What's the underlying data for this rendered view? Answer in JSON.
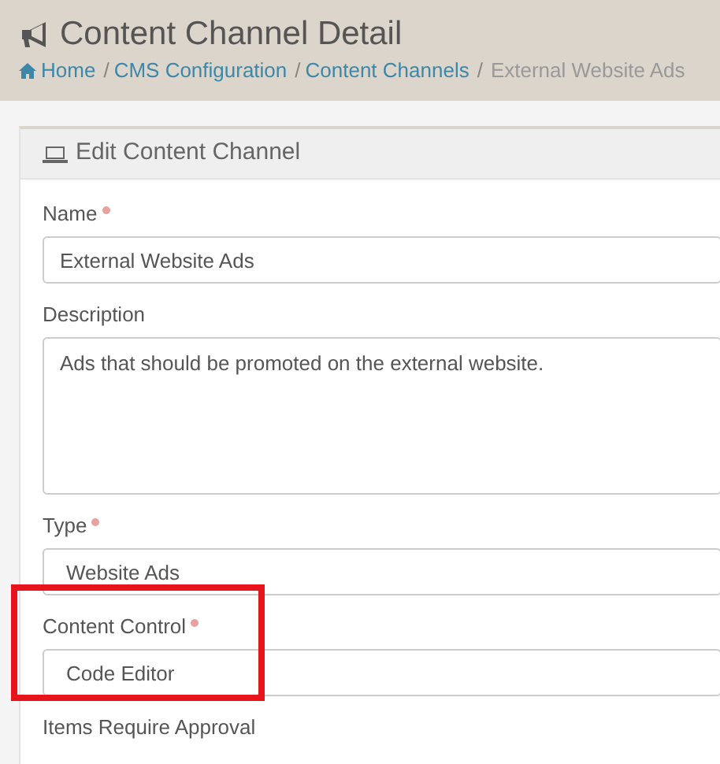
{
  "page": {
    "title": "Content Channel Detail"
  },
  "breadcrumb": [
    {
      "kind": "link",
      "label": "Home",
      "link": true
    },
    {
      "kind": "separator",
      "label": "/"
    },
    {
      "kind": "link",
      "label": "CMS Configuration",
      "link": true
    },
    {
      "kind": "separator",
      "label": "/"
    },
    {
      "kind": "link",
      "label": "Content Channels",
      "link": true
    },
    {
      "kind": "separator",
      "label": "/"
    },
    {
      "kind": "link",
      "label": "External Website Ads",
      "link": false
    }
  ],
  "panel": {
    "title": "Edit Content Channel"
  },
  "fields": [
    {
      "kind": "text",
      "label": "Name",
      "required": true,
      "value": "External Website Ads",
      "highlighted": false
    },
    {
      "kind": "textarea",
      "label": "Description",
      "required": false,
      "value": "Ads that should be promoted on the external website.",
      "highlighted": false
    },
    {
      "kind": "select",
      "label": "Type",
      "required": true,
      "value": "Website Ads",
      "highlighted": false
    },
    {
      "kind": "select",
      "label": "Content Control",
      "required": true,
      "value": "Code Editor",
      "highlighted": true
    },
    {
      "kind": "heading",
      "label": "Items Require Approval",
      "required": false,
      "highlighted": false
    }
  ]
}
